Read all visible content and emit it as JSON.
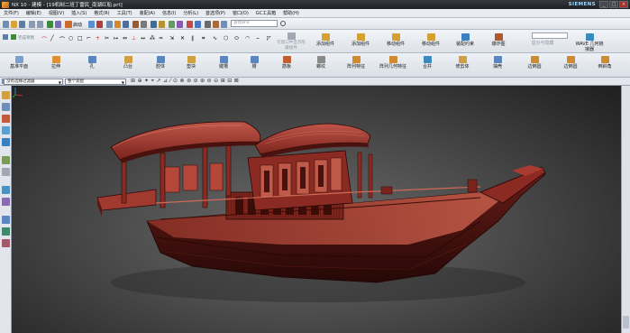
{
  "window": {
    "title": "NX 10 - 建模 - [19机制二班丁雷民_南湖红船.prt]",
    "brand": "SIEMENS",
    "controls": [
      "_",
      "□",
      "×"
    ]
  },
  "menubar": {
    "items": [
      "文件(F)",
      "编辑(E)",
      "视图(V)",
      "插入(S)",
      "格式(R)",
      "工具(T)",
      "装配(A)",
      "信息(I)",
      "分析(L)",
      "首选项(P)",
      "窗口(O)",
      "GC工具箱",
      "帮助(H)"
    ]
  },
  "quick_toolbar": {
    "start_label": "启动",
    "search_placeholder": "查找命令"
  },
  "sketch_toolbar": {
    "finish_sketch": "完成草图",
    "disabled_group": [
      "在窗口中显示隐藏组件",
      "",
      ""
    ],
    "assembly_buttons": [
      "添加组件",
      "移动组件",
      "移动组件",
      "装配约束",
      "爆炸图",
      "显示与隐藏",
      "WAVE 几何链接器"
    ]
  },
  "feature_toolbar": {
    "buttons": [
      "基准平面",
      "拉伸",
      "孔",
      "凸台",
      "腔体",
      "垫块",
      "键槽",
      "槽",
      "筋板",
      "螺纹",
      "阵列特征",
      "阵列几何特征",
      "合并",
      "修剪体",
      "抽壳",
      "边倒圆",
      "边倒圆",
      "倒斜角"
    ]
  },
  "selection_bar": {
    "filter": "没有选择过滤器",
    "scope": "整个装配"
  },
  "colors": {
    "boat_red": "#7a241c",
    "boat_red_light": "#b4473a",
    "hull_dark": "#3e0f0b",
    "viewport_bg": "#4a4a4a"
  }
}
